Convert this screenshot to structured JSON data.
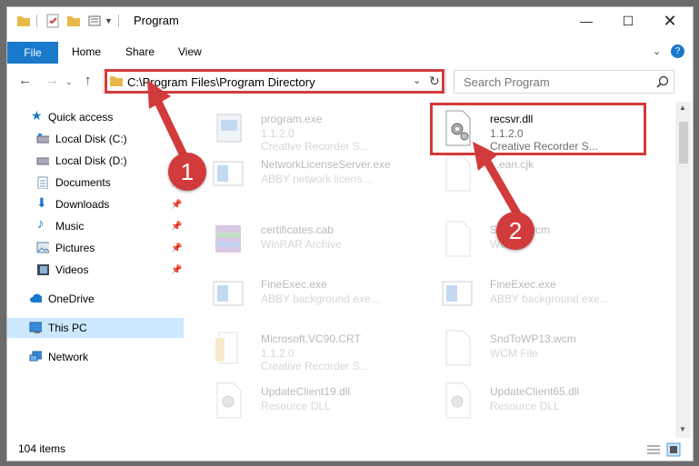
{
  "window": {
    "title": "Program"
  },
  "ribbon": {
    "tabs": [
      "File",
      "Home",
      "Share",
      "View"
    ]
  },
  "address": {
    "path": "C:\\Program Files\\Program Directory"
  },
  "search": {
    "placeholder": "Search Program"
  },
  "sidebar": {
    "items": [
      {
        "label": "Quick access",
        "icon": "star-icon"
      },
      {
        "label": "Local Disk (C:)",
        "icon": "drive-icon"
      },
      {
        "label": "Local Disk (D:)",
        "icon": "drive-icon"
      },
      {
        "label": "Documents",
        "icon": "documents-icon",
        "pinned": true
      },
      {
        "label": "Downloads",
        "icon": "downloads-icon",
        "pinned": true
      },
      {
        "label": "Music",
        "icon": "music-icon",
        "pinned": true
      },
      {
        "label": "Pictures",
        "icon": "pictures-icon",
        "pinned": true
      },
      {
        "label": "Videos",
        "icon": "videos-icon",
        "pinned": true
      },
      {
        "label": "OneDrive",
        "icon": "cloud-icon"
      },
      {
        "label": "This PC",
        "icon": "computer-icon",
        "selected": true
      },
      {
        "label": "Network",
        "icon": "network-icon"
      }
    ]
  },
  "files": [
    {
      "name": "program.exe",
      "line2": "1.1.2.0",
      "line3": "Creative Recorder S...",
      "icon": "exe-icon"
    },
    {
      "name": "recsvr.dll",
      "line2": "1.1.2.0",
      "line3": "Creative Recorder S...",
      "icon": "dll-gear-icon",
      "highlighted": true
    },
    {
      "name": "NetworkLicenseServer.exe",
      "line2": "ABBY network licens...",
      "line3": "",
      "icon": "exe-window-icon"
    },
    {
      "name": "...ean.cjk",
      "line2": "...",
      "line3": "",
      "icon": "file-icon"
    },
    {
      "name": "certificates.cab",
      "line2": "WinRAR Archive",
      "line3": "",
      "icon": "archive-icon"
    },
    {
      "name": "Snd...5.wcm",
      "line2": "WCM...",
      "line3": "",
      "icon": "file-icon"
    },
    {
      "name": "FineExec.exe",
      "line2": "ABBY background exe...",
      "line3": "",
      "icon": "exe-window-icon"
    },
    {
      "name": "FineExec.exe",
      "line2": "ABBY background exe...",
      "line3": "",
      "icon": "exe-window-icon"
    },
    {
      "name": "Microsoft.VC90.CRT",
      "line2": "1.1.2.0",
      "line3": "Creative Recorder S...",
      "icon": "folder-doc-icon"
    },
    {
      "name": "SndToWP13.wcm",
      "line2": "WCM File",
      "line3": "",
      "icon": "file-icon"
    },
    {
      "name": "UpdateClient19.dll",
      "line2": "Resource DLL",
      "line3": "",
      "icon": "dll-gear-icon"
    },
    {
      "name": "UpdateClient65.dll",
      "line2": "Resource DLL",
      "line3": "",
      "icon": "dll-gear-icon"
    }
  ],
  "status": {
    "item_count": "104 items"
  },
  "annotations": {
    "step1": "1",
    "step2": "2"
  },
  "colors": {
    "accent": "#1979ca",
    "highlight": "#d23b3b",
    "selected_bg": "#cce8ff"
  }
}
